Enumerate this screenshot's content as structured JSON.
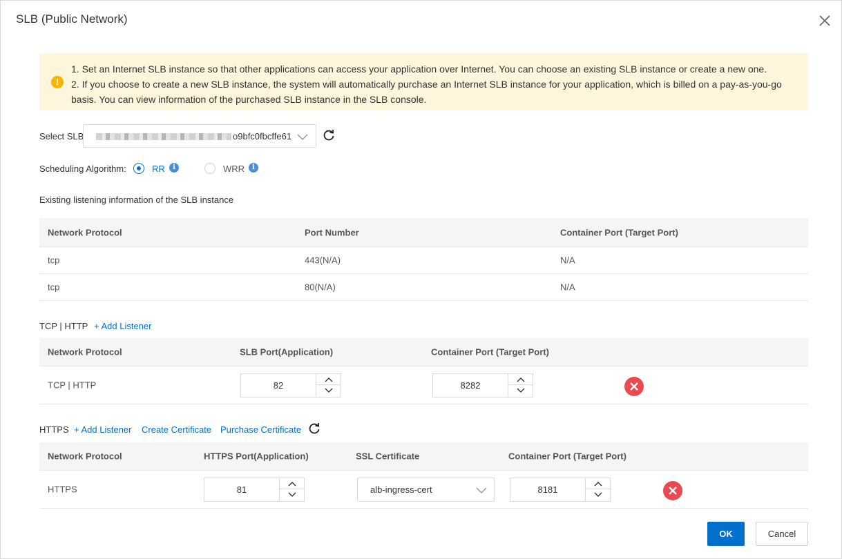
{
  "dialog": {
    "title": "SLB (Public Network)"
  },
  "notice": {
    "line1": "1. Set an Internet SLB instance so that other applications can access your application over Internet. You can choose an existing SLB instance or create a new one.",
    "line2": "2. If you choose to create a new SLB instance, the system will automatically purchase an Internet SLB instance for your application, which is billed on a pay-as-you-go basis. You can view information of the purchased SLB instance in the SLB console."
  },
  "select_slb": {
    "label": "Select SLB:",
    "value": "o9bfc0fbcffe61"
  },
  "scheduling": {
    "label": "Scheduling Algorithm:",
    "options": [
      {
        "label": "RR",
        "selected": true
      },
      {
        "label": "WRR",
        "selected": false
      }
    ]
  },
  "existing": {
    "heading": "Existing listening information of the SLB instance",
    "columns": [
      "Network Protocol",
      "Port Number",
      "Container Port (Target Port)"
    ],
    "rows": [
      [
        "tcp",
        "443(N/A)",
        "N/A"
      ],
      [
        "tcp",
        "80(N/A)",
        "N/A"
      ]
    ]
  },
  "tcp_http": {
    "heading": "TCP | HTTP",
    "add_listener": "+ Add Listener",
    "columns": [
      "Network Protocol",
      "SLB Port(Application)",
      "Container Port (Target Port)"
    ],
    "row": {
      "protocol": "TCP | HTTP",
      "slb_port": "82",
      "container_port": "8282"
    }
  },
  "https": {
    "heading": "HTTPS",
    "add_listener": "+ Add Listener",
    "create_certificate": "Create Certificate",
    "purchase_certificate": "Purchase Certificate",
    "columns": [
      "Network Protocol",
      "HTTPS Port(Application)",
      "SSL Certificate",
      "Container Port (Target Port)"
    ],
    "row": {
      "protocol": "HTTPS",
      "https_port": "81",
      "certificate": "alb-ingress-cert",
      "container_port": "8181"
    }
  },
  "footer": {
    "ok": "OK",
    "cancel": "Cancel"
  },
  "colors": {
    "primary": "#0070cc",
    "danger": "#e84a4f",
    "notice_bg": "#fdf5dc",
    "warning": "#f7b500"
  }
}
